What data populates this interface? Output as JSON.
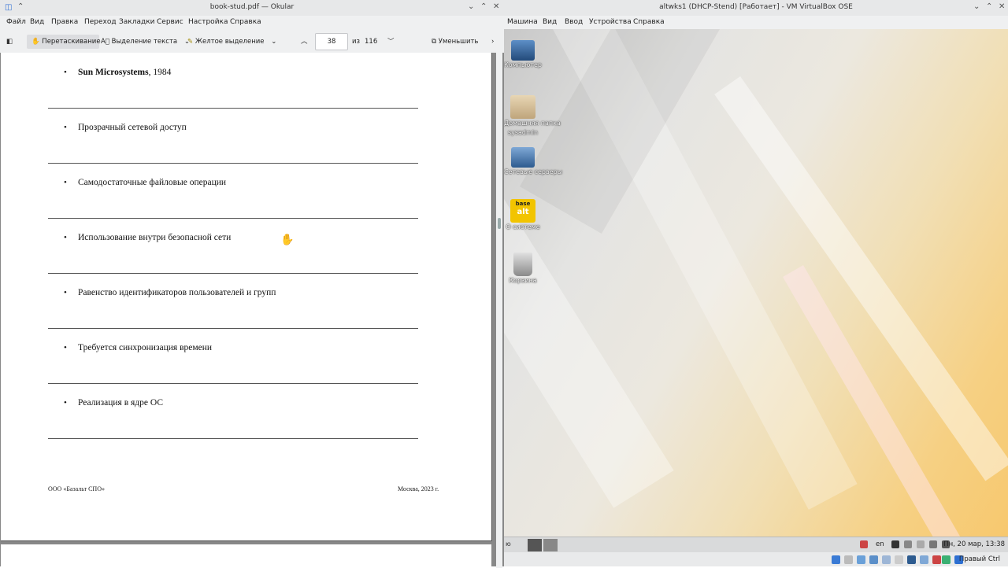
{
  "okular": {
    "title": "book-stud.pdf — Okular",
    "menu": [
      "Файл",
      "Вид",
      "Правка",
      "Переход",
      "Закладки",
      "Сервис",
      "Настройка",
      "Справка"
    ],
    "toolbar": {
      "drag_label": "Перетаскивание",
      "text_select_label": "Выделение текста",
      "highlight_label": "Желтое выделение",
      "page_current": "38",
      "page_of": "из",
      "page_total": "116",
      "zoom_out_label": "Уменьшить"
    },
    "document": {
      "items": [
        {
          "bold": "Sun Microsystems",
          "rest": ", 1984"
        },
        {
          "bold": "",
          "rest": "Прозрачный сетевой доступ"
        },
        {
          "bold": "",
          "rest": "Самодостаточные файловые операции"
        },
        {
          "bold": "",
          "rest": "Использование внутри безопасной сети"
        },
        {
          "bold": "",
          "rest": "Равенство идентификаторов пользователей и групп"
        },
        {
          "bold": "",
          "rest": "Требуется синхронизация времени"
        },
        {
          "bold": "",
          "rest": "Реализация в ядре ОС"
        }
      ],
      "bullet": "•",
      "footer_left": "ООО «Базальт СПО»",
      "footer_right": "Москва, 2023 г."
    }
  },
  "vbox": {
    "title": "altwks1 (DHCP-Stend) [Работает] - VM VirtualBox OSE",
    "menu": [
      "Машина",
      "Вид",
      "Ввод",
      "Устройства",
      "Справка"
    ],
    "desktop_icons": [
      {
        "label": "Компьютер",
        "icon": "computer-icon"
      },
      {
        "label": "Домашняя папка",
        "label2": "sysadmin",
        "icon": "home-folder-icon"
      },
      {
        "label": "Сетевые серверы",
        "icon": "network-servers-icon"
      },
      {
        "label": "О системе",
        "icon": "about-system-icon",
        "logo_top": "base",
        "logo_bottom": "alt"
      },
      {
        "label": "Корзина",
        "icon": "trash-icon"
      }
    ],
    "panel": {
      "lang": "en",
      "clock": "Пн, 20 мар, 13:38"
    },
    "status": {
      "host_key": "Правый Ctrl"
    }
  }
}
